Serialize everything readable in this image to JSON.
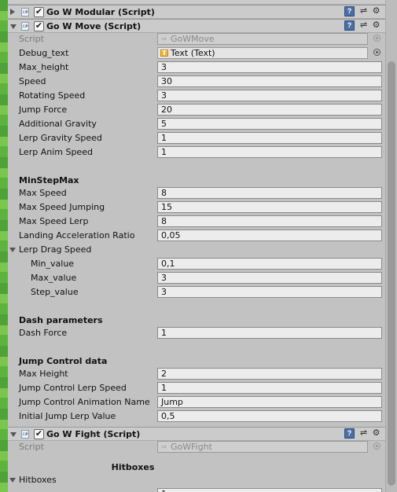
{
  "components": {
    "modular": {
      "title": "Go W Modular (Script)",
      "enabled": true
    },
    "move": {
      "title": "Go W Move (Script)",
      "enabled": true
    },
    "fight": {
      "title": "Go W Fight (Script)",
      "enabled": true
    }
  },
  "move": {
    "script_label": "Script",
    "script_value": "GoWMove",
    "debug_label": "Debug_text",
    "debug_value": "Text (Text)",
    "fields": [
      {
        "label": "Max_height",
        "value": "3"
      },
      {
        "label": "Speed",
        "value": "30"
      },
      {
        "label": "Rotating Speed",
        "value": "3"
      },
      {
        "label": "Jump Force",
        "value": "20"
      },
      {
        "label": "Additional Gravity",
        "value": "5"
      },
      {
        "label": "Lerp Gravity Speed",
        "value": "1"
      },
      {
        "label": "Lerp Anim Speed",
        "value": "1"
      }
    ],
    "section_minstep": "MinStepMax",
    "minstep_fields": [
      {
        "label": "Max Speed",
        "value": "8"
      },
      {
        "label": "Max Speed Jumping",
        "value": "15"
      },
      {
        "label": "Max Speed Lerp",
        "value": "8"
      },
      {
        "label": "Landing Acceleration Ratio",
        "value": "0,05"
      }
    ],
    "lerp_drag_label": "Lerp Drag Speed",
    "lerp_drag_fields": [
      {
        "label": "Min_value",
        "value": "0,1"
      },
      {
        "label": "Max_value",
        "value": "3"
      },
      {
        "label": "Step_value",
        "value": "3"
      }
    ],
    "section_dash": "Dash parameters",
    "dash_fields": [
      {
        "label": "Dash Force",
        "value": "1"
      }
    ],
    "section_jump": "Jump Control data",
    "jump_fields": [
      {
        "label": "Max Height",
        "value": "2"
      },
      {
        "label": "Jump Control Lerp Speed",
        "value": "1"
      },
      {
        "label": "Jump Control Animation Name",
        "value": "Jump"
      },
      {
        "label": "Initial Jump Lerp Value",
        "value": "0,5"
      }
    ]
  },
  "fight": {
    "script_label": "Script",
    "script_value": "GoWFight",
    "hitboxes_header": "Hitboxes",
    "hitboxes_label": "Hitboxes",
    "size_value": "1"
  },
  "icons": {
    "cs": "cs-script-icon",
    "book": "help-book-icon",
    "presets": "presets-icon",
    "gear": "gear-icon"
  }
}
